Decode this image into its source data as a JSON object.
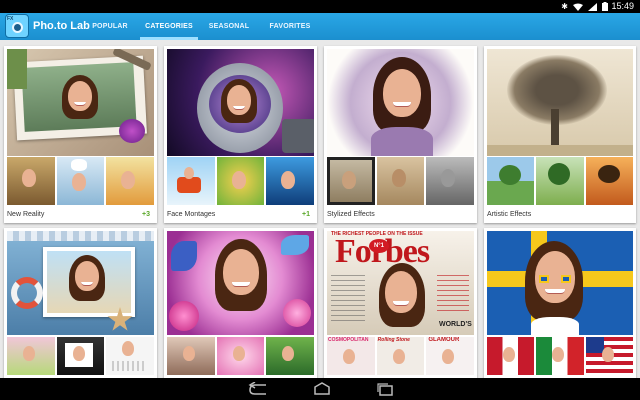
{
  "status_bar": {
    "time": "15:49",
    "icons": [
      "bluetooth-icon",
      "wifi-icon",
      "signal-icon",
      "battery-icon"
    ]
  },
  "app": {
    "title": "Pho.to Lab",
    "logo_tag": "FX",
    "tabs": [
      {
        "label": "POPULAR",
        "active": false
      },
      {
        "label": "CATEGORIES",
        "active": true
      },
      {
        "label": "SEASONAL",
        "active": false
      },
      {
        "label": "FAVORITES",
        "active": false
      }
    ]
  },
  "colors": {
    "action_bar": "#1f9ad9",
    "badge_green": "#5ba82a",
    "tab_indicator": "#9fe0ff"
  },
  "categories": [
    {
      "label": "New Reality",
      "badge": "+3"
    },
    {
      "label": "Face Montages",
      "badge": "+1"
    },
    {
      "label": "Stylized Effects",
      "badge": ""
    },
    {
      "label": "Artistic Effects",
      "badge": ""
    },
    {
      "label": "",
      "badge": ""
    },
    {
      "label": "",
      "badge": ""
    },
    {
      "label": "",
      "badge": ""
    },
    {
      "label": "",
      "badge": ""
    }
  ],
  "forbes_cover": {
    "tagline": "THE RICHEST PEOPLE ON THE ISSUE",
    "masthead": "Forbes",
    "badge": "N°1",
    "footer": "WORLD'S"
  },
  "magazine_thumbs": [
    "COSMOPOLITAN",
    "Rolling Stone",
    "GLAMOUR"
  ],
  "system_nav": [
    "back-icon",
    "home-icon",
    "recent-apps-icon"
  ]
}
